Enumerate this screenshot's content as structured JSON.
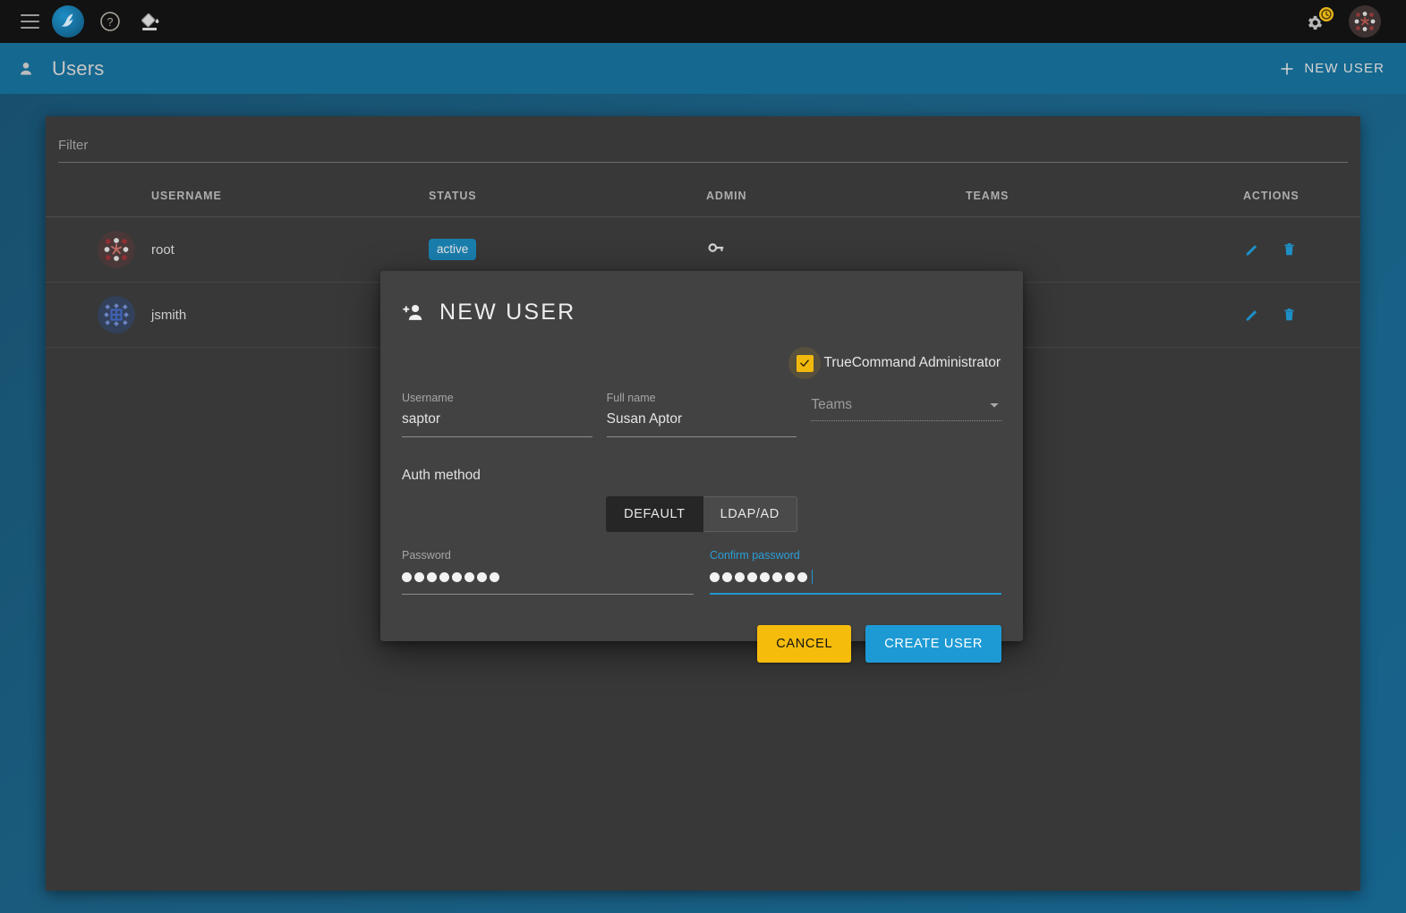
{
  "topbar": {
    "menu_icon": "hamburger-menu-icon",
    "logo_icon": "truenas-logo-icon",
    "help_icon": "help-circle-icon",
    "theme_icon": "paint-bucket-icon",
    "settings_icon": "gear-icon",
    "update_badge_icon": "update-clock-icon",
    "avatar_icon": "user-avatar-identicon",
    "colors": {
      "background": "#121212",
      "badge": "#e8b41a"
    }
  },
  "pageheader": {
    "person_icon": "person-icon",
    "title": "Users",
    "new_user_label": "NEW USER",
    "plus_icon": "plus-icon",
    "colors": {
      "background": "#15688f",
      "text": "#c6c6c6"
    }
  },
  "filter": {
    "placeholder": "Filter",
    "value": ""
  },
  "table": {
    "columns": [
      "USERNAME",
      "STATUS",
      "ADMIN",
      "TEAMS",
      "ACTIONS"
    ],
    "rows": [
      {
        "avatar_icon": "identicon-root",
        "username": "root",
        "status": "active",
        "admin_icon": "key-icon",
        "teams": "",
        "edit_icon": "pencil-icon",
        "delete_icon": "trash-icon"
      },
      {
        "avatar_icon": "identicon-jsmith",
        "username": "jsmith",
        "status": "",
        "admin_icon": "",
        "teams": "",
        "edit_icon": "pencil-icon",
        "delete_icon": "trash-icon"
      }
    ],
    "colors": {
      "card": "#383838",
      "badge_active": "#1a7ead",
      "action_icon": "#1e8fc6"
    }
  },
  "modal": {
    "title": "NEW USER",
    "title_icon": "person-add-icon",
    "admin_checkbox": {
      "label": "TrueCommand Administrator",
      "checked": true,
      "color": "#f2b90d"
    },
    "username_field": {
      "label": "Username",
      "value": "saptor",
      "placeholder": ""
    },
    "fullname_field": {
      "label": "Full name",
      "value": "Susan Aptor",
      "placeholder": ""
    },
    "teams_field": {
      "label": "",
      "placeholder": "Teams",
      "value": "",
      "chevron_icon": "chevron-down-icon"
    },
    "auth_method": {
      "title": "Auth method",
      "options": [
        "DEFAULT",
        "LDAP/AD"
      ],
      "selected": "DEFAULT"
    },
    "password_field": {
      "label": "Password",
      "value": "••••••••",
      "dots": 8,
      "focused": false
    },
    "confirm_password_field": {
      "label": "Confirm password",
      "value": "••••••••",
      "dots": 8,
      "focused": true
    },
    "buttons": {
      "cancel": "CANCEL",
      "create": "CREATE USER"
    },
    "colors": {
      "background": "#424242",
      "accent": "#2196cf",
      "cancel": "#f5bc0c",
      "create": "#1d9ad4"
    }
  }
}
